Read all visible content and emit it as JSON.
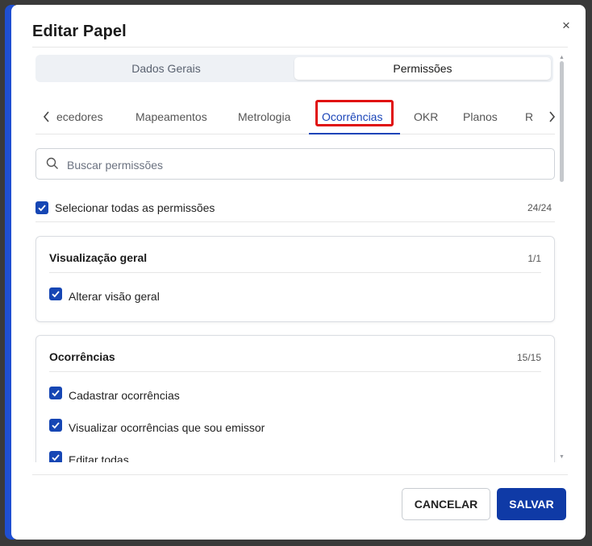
{
  "dialog": {
    "title": "Editar Papel",
    "close_icon": "×"
  },
  "segmented": {
    "left": "Dados Gerais",
    "right": "Permissões",
    "selected": "Permissões"
  },
  "tabs": {
    "items": [
      "ecedores",
      "Mapeamentos",
      "Metrologia",
      "Ocorrências",
      "OKR",
      "Planos",
      "R"
    ],
    "active": "Ocorrências",
    "prev_icon": "chevron-left-icon",
    "next_icon": "chevron-right-icon"
  },
  "search": {
    "placeholder": "Buscar permissões",
    "value": "",
    "icon": "search-icon"
  },
  "select_all": {
    "label": "Selecionar todas as permissões",
    "count": "24/24",
    "checked": true
  },
  "groups": [
    {
      "title": "Visualização geral",
      "count": "1/1",
      "items": [
        {
          "label": "Alterar visão geral",
          "checked": true
        }
      ]
    },
    {
      "title": "Ocorrências",
      "count": "15/15",
      "items": [
        {
          "label": "Cadastrar ocorrências",
          "checked": true
        },
        {
          "label": "Visualizar ocorrências que sou emissor",
          "checked": true
        },
        {
          "label": "Editar todas",
          "checked": true
        }
      ]
    }
  ],
  "footer": {
    "cancel": "CANCELAR",
    "save": "SALVAR"
  },
  "colors": {
    "accent": "#1646b4",
    "primary_button": "#0f3aa6",
    "active_tab_highlight": "#e01010"
  }
}
